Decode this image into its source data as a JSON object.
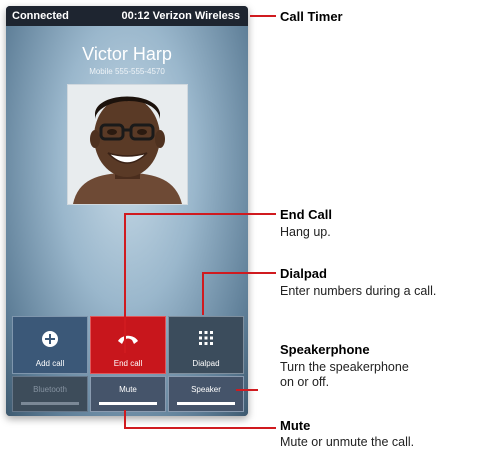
{
  "status_bar": {
    "state": "Connected",
    "timer_carrier": "00:12 Verizon Wireless"
  },
  "caller": {
    "name": "Victor Harp",
    "number": "Mobile 555-555-4570"
  },
  "buttons": {
    "add_call": "Add call",
    "end_call": "End call",
    "dialpad": "Dialpad",
    "bluetooth": "Bluetooth",
    "mute": "Mute",
    "speaker": "Speaker"
  },
  "annotations": {
    "call_timer": {
      "title": "Call Timer"
    },
    "end_call": {
      "title": "End Call",
      "desc": "Hang up."
    },
    "dialpad": {
      "title": "Dialpad",
      "desc": "Enter numbers during a call."
    },
    "speakerphone": {
      "title": "Speakerphone",
      "desc_line1": "Turn the speakerphone",
      "desc_line2": "on or off."
    },
    "mute": {
      "title": "Mute",
      "desc": "Mute or unmute the call."
    }
  },
  "colors": {
    "accent": "#d01a1f",
    "end_call": "#c8161c"
  }
}
